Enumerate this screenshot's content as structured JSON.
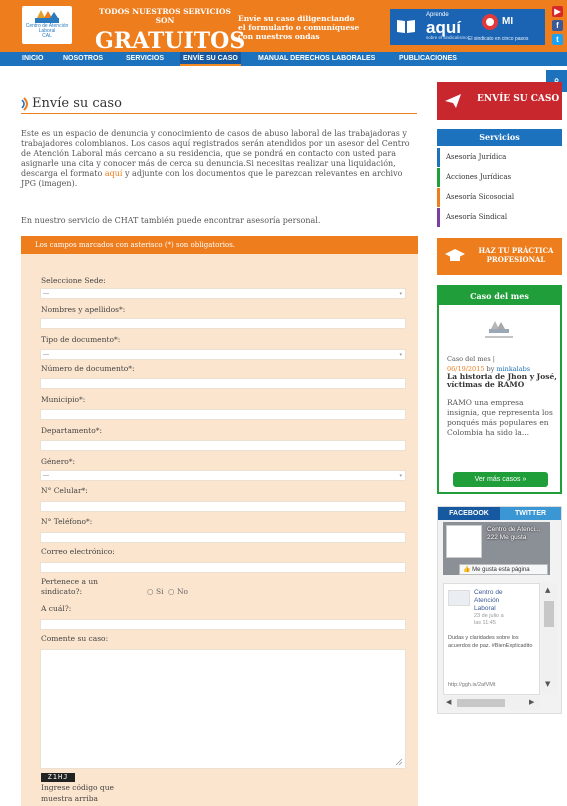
{
  "header": {
    "logo_text": "Centro de Atención Laboral",
    "logo_sub": "CAL",
    "promo_line1": "TODOS NUESTROS SERVICIOS",
    "promo_line2": "SON",
    "promo_big": "GRATUITOS",
    "promo_send": "Envíe su caso diligenciando el formulario o comuníquese con nuestros ondas",
    "learn_small": "Aprende",
    "learn_aqui": "aquí",
    "learn_caption": "sobre el sindicalismo",
    "learn_mi": "MI",
    "learn_sub": "El sindicato en cinco pasos",
    "social": {
      "youtube": "▶",
      "facebook": "f",
      "twitter": "t"
    },
    "colors": {
      "orange": "#ee7d1e",
      "blue": "#1d72bd"
    }
  },
  "nav": {
    "items": [
      "INICIO",
      "NOSOTROS",
      "SERVICIOS",
      "ENVÍE SU CASO",
      "MANUAL DERECHOS LABORALES",
      "PUBLICACIONES"
    ],
    "search_icon": "search-icon"
  },
  "main": {
    "title": "Envíe su caso",
    "intro_part1": "Este es un espacio de denuncia y conocimiento de casos de abuso laboral de las trabajadoras y trabajadores colombianos. Los casos aquí registrados serán atendidos por un asesor del Centro de Atención Laboral más cercano a su residencia, que se pondrá en contacto con usted para asignarle una cita y conocer más de cerca su denuncia.Si necesitas realizar una liquidación, descarga el formato ",
    "intro_link": "aquí",
    "intro_part2": " y adjunte con los documentos que le parezcan relevantes en archivo JPG (imagen).",
    "chat_note": "En nuestro servicio de CHAT también puede encontrar asesoría personal."
  },
  "form": {
    "header": "Los campos marcados con asterisco (*) son obligatorios.",
    "sede_label": "Seleccione Sede:",
    "sede_value": "---",
    "nombres_label": "Nombres y apellidos*:",
    "tipo_doc_label": "Tipo de documento*:",
    "tipo_doc_value": "---",
    "num_doc_label": "Número de documento*:",
    "municipio_label": "Municipio*:",
    "departamento_label": "Departamento*:",
    "genero_label": "Género*:",
    "genero_value": "---",
    "celular_label": "N° Celular*:",
    "telefono_label": "N° Teléfono*:",
    "correo_label": "Correo electrónico:",
    "sindicato_label_1": "Pertenece a un",
    "sindicato_label_2": "sindicato?:",
    "radio_si": "Si",
    "radio_no": "No",
    "cual_label": "A cuál?:",
    "comente_label": "Comente su caso:",
    "captcha_text": "Z1HJ",
    "captcha_label_1": "Ingrese código que",
    "captcha_label_2": "muestra arriba"
  },
  "sidebar": {
    "send_case": "ENVÍE SU CASO",
    "services_header": "Servicios",
    "services": [
      {
        "label": "Asesoría Jurídica",
        "color": "#1d72bd"
      },
      {
        "label": "Acciones Jurídicas",
        "color": "#1f9e3a"
      },
      {
        "label": "Asesoría Sicosocial",
        "color": "#ee7d1e"
      },
      {
        "label": "Asesoría Sindical",
        "color": "#7a3fa0"
      }
    ],
    "practice_1": "HAZ TU PRÁCTICA",
    "practice_2": "PROFESIONAL",
    "case_header": "Caso del mes",
    "case_cat": "Caso del mes",
    "case_sep": " | ",
    "case_date": "06/19/2015",
    "case_by_word": " by ",
    "case_author": "minkalabs",
    "case_title": "La historia de Jhon y José, víctimas de RAMO",
    "case_excerpt": "RAMO una empresa insignia, que representa los ponqués más populares en Colombia ha sido la...",
    "case_more": "Ver más casos",
    "social_tabs": [
      "FACEBOOK",
      "TWITTER"
    ],
    "fb_page": "Centro de Atenci...",
    "fb_likes": "222 Me gusta",
    "fb_like_button": "Me gusta esta página",
    "fb_post_author_1": "Centro de",
    "fb_post_author_2": "Atención",
    "fb_post_author_3": "Laboral",
    "fb_post_date_1": "23 de julio a",
    "fb_post_date_2": "las 11:45",
    "fb_post_text": "Dudas y claridades sobre los acuerdos de paz. #BienExplicadito",
    "fb_post_link": "http://ggh.is/2afVMt"
  }
}
